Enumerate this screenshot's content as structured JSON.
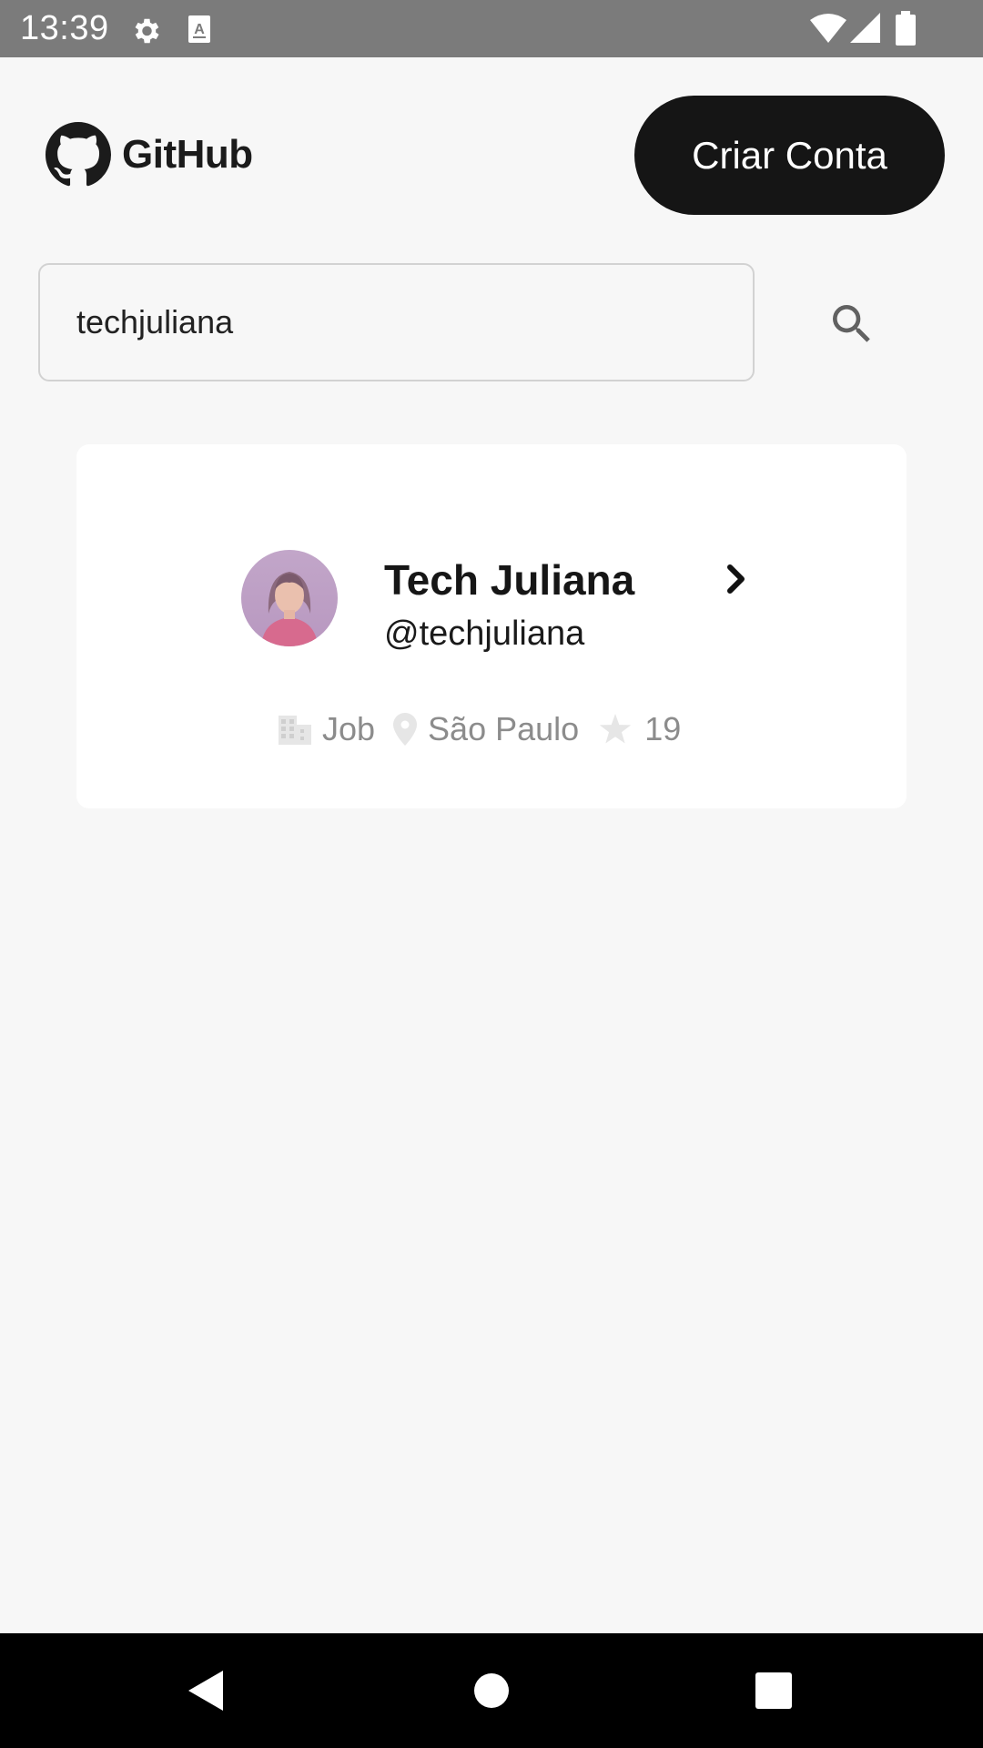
{
  "status_bar": {
    "time": "13:39",
    "icons": [
      "gear-icon",
      "keyboard-a-icon",
      "wifi-icon",
      "signal-icon",
      "battery-icon"
    ]
  },
  "header": {
    "logo_text": "GitHub",
    "create_account_label": "Criar Conta"
  },
  "search": {
    "value": "techjuliana",
    "icon": "search-icon"
  },
  "result_card": {
    "name": "Tech Juliana",
    "login": "@techjuliana",
    "company": "Job",
    "location": "São Paulo",
    "stars": "19"
  },
  "nav_bar": {
    "icons": [
      "back-icon",
      "home-icon",
      "recents-icon"
    ]
  },
  "colors": {
    "status_bar": "#7b7b7b",
    "background": "#f7f7f7",
    "button": "#151515",
    "card": "#ffffff",
    "meta_text": "#8c8c8c"
  }
}
